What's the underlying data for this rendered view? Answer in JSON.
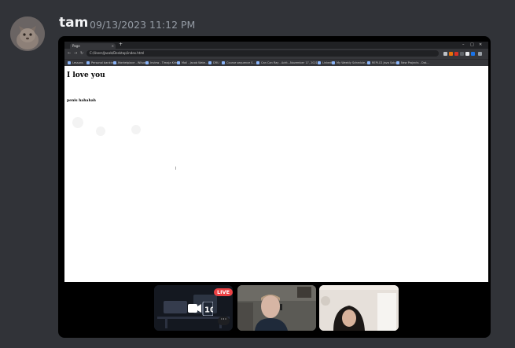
{
  "message": {
    "author": "tam",
    "timestamp": "09/13/2023 11:12 PM",
    "avatar_icon": "cat-avatar"
  },
  "browser": {
    "tab_title": "Page",
    "url": "C:/Users/Jacob/Desktop/index.html",
    "bookmarks": [
      "Lessons",
      "Personal banking ...",
      "Marketplace - Wilson...",
      "Inview - Timaja Kirk...",
      "Mail - Jacob Wate...",
      "DRU",
      "Course sequence S...",
      "Can Can Ray - Acht...",
      "November 17, 2021...",
      "Linkedin",
      "My Weekly Schedule...",
      "REPLCS Java Solo...",
      "New Projects - Dat..."
    ]
  },
  "page": {
    "heading": "I love you",
    "text": "penis hahahah"
  },
  "stream": {
    "live_label": "LIVE",
    "more_label": "···",
    "colors": {
      "live": "#ed4245",
      "embed_bg": "#000000",
      "app_bg": "#313338"
    }
  }
}
